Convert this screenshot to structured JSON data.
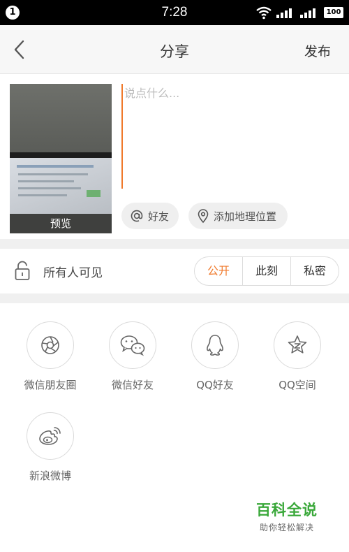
{
  "status_bar": {
    "notification_count": "1",
    "time": "7:28",
    "battery": "100",
    "icons": [
      "wifi-icon",
      "signal-icon",
      "signal-icon"
    ]
  },
  "nav": {
    "title": "分享",
    "publish_label": "发布",
    "back_icon": "chevron-left-icon"
  },
  "compose": {
    "placeholder": "说点什么...",
    "preview_label": "预览",
    "friends_chip": "好友",
    "location_chip": "添加地理位置"
  },
  "visibility": {
    "label": "所有人可见",
    "options": [
      "公开",
      "此刻",
      "私密"
    ],
    "selected": "公开",
    "accent_color": "#f07a2c"
  },
  "share_targets": [
    {
      "label": "微信朋友圈",
      "icon": "moments-icon"
    },
    {
      "label": "微信好友",
      "icon": "wechat-icon"
    },
    {
      "label": "QQ好友",
      "icon": "qq-icon"
    },
    {
      "label": "QQ空间",
      "icon": "qzone-icon"
    },
    {
      "label": "新浪微博",
      "icon": "weibo-icon"
    }
  ],
  "watermark": {
    "title": "百科全说",
    "subtitle": "助你轻松解决"
  }
}
